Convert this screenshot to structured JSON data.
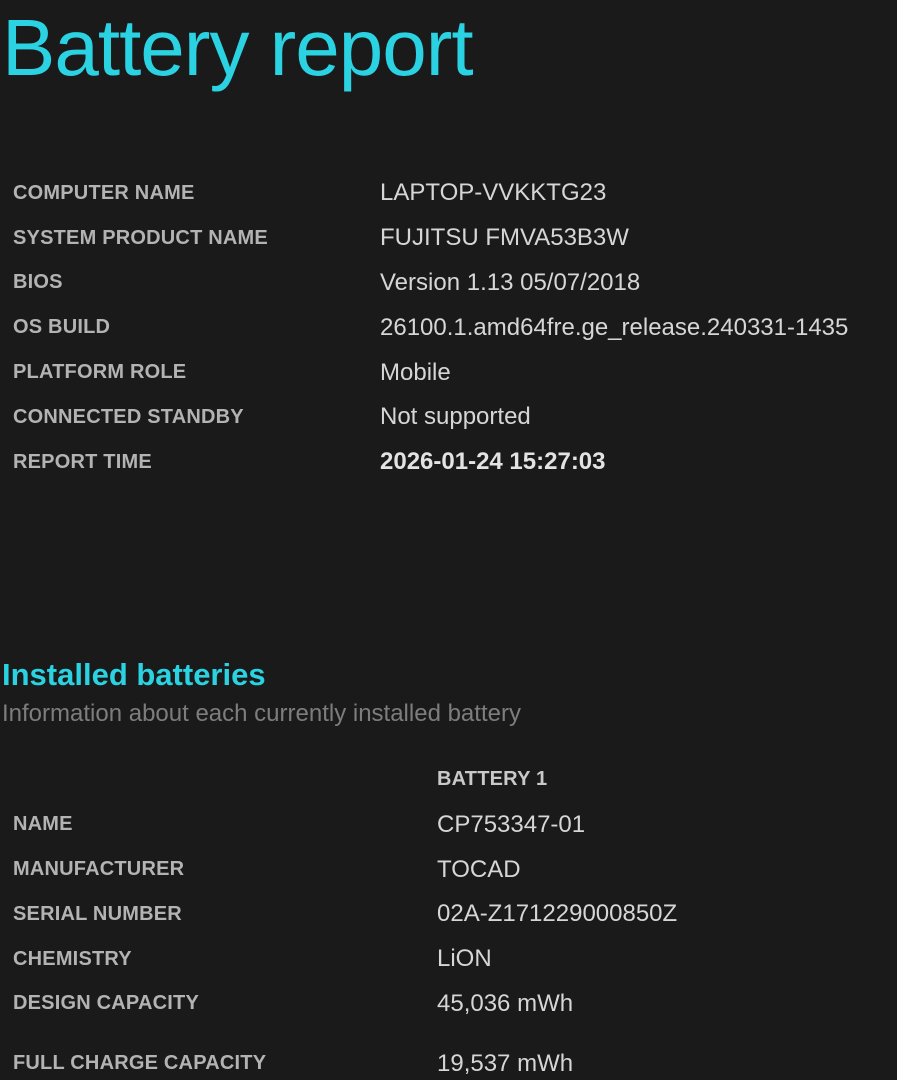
{
  "title": "Battery report",
  "colors": {
    "background": "#1a1a1a",
    "accent": "#2ad2e2",
    "label": "#b3b3b3",
    "value": "#d6d6d6",
    "subtitle": "#7d7d7d"
  },
  "system_info": {
    "rows": [
      {
        "label": "COMPUTER NAME",
        "value": "LAPTOP-VVKKTG23"
      },
      {
        "label": "SYSTEM PRODUCT NAME",
        "value": "FUJITSU FMVA53B3W"
      },
      {
        "label": "BIOS",
        "value": "Version 1.13 05/07/2018"
      },
      {
        "label": "OS BUILD",
        "value": "26100.1.amd64fre.ge_release.240331-1435"
      },
      {
        "label": "PLATFORM ROLE",
        "value": "Mobile"
      },
      {
        "label": "CONNECTED STANDBY",
        "value": "Not supported"
      },
      {
        "label": "REPORT TIME",
        "value": "2026-01-24  15:27:03"
      }
    ]
  },
  "installed_batteries": {
    "heading": "Installed batteries",
    "subtitle": "Information about each currently installed battery",
    "column_header": "BATTERY 1",
    "rows": [
      {
        "label": "NAME",
        "value": "CP753347-01"
      },
      {
        "label": "MANUFACTURER",
        "value": "TOCAD"
      },
      {
        "label": "SERIAL NUMBER",
        "value": "02A-Z171229000850Z"
      },
      {
        "label": "CHEMISTRY",
        "value": "LiON"
      },
      {
        "label": "DESIGN CAPACITY",
        "value": "45,036 mWh"
      },
      {
        "label": "FULL CHARGE CAPACITY",
        "value": "19,537 mWh"
      }
    ]
  }
}
